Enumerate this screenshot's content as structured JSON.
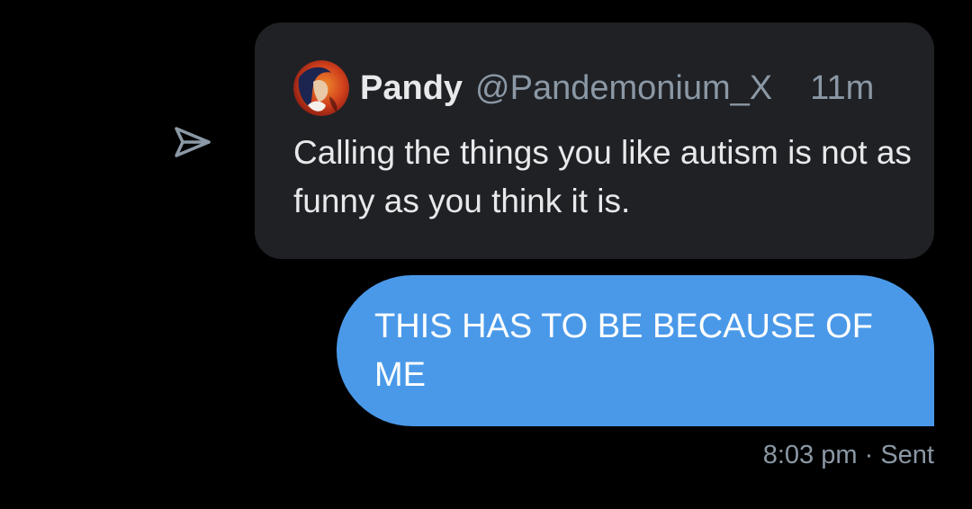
{
  "icons": {
    "share": "share-send-icon",
    "avatar": "user-avatar"
  },
  "quoted_tweet": {
    "author_name": "Pandy",
    "author_handle": "@Pandemonium_X",
    "time": "11m",
    "text": "Calling the things you like autism is not as funny as you think it is."
  },
  "message": {
    "text": "THIS HAS TO BE BECAUSE OF ME",
    "timestamp": "8:03 pm",
    "separator": "·",
    "status": "Sent"
  },
  "colors": {
    "background": "#000000",
    "quoted_tweet_bg": "#1f2125",
    "sent_bubble_bg": "#4a99e9",
    "primary_text": "#e7e9ea",
    "secondary_text": "#8b98a5",
    "icon": "#8b98a5"
  }
}
